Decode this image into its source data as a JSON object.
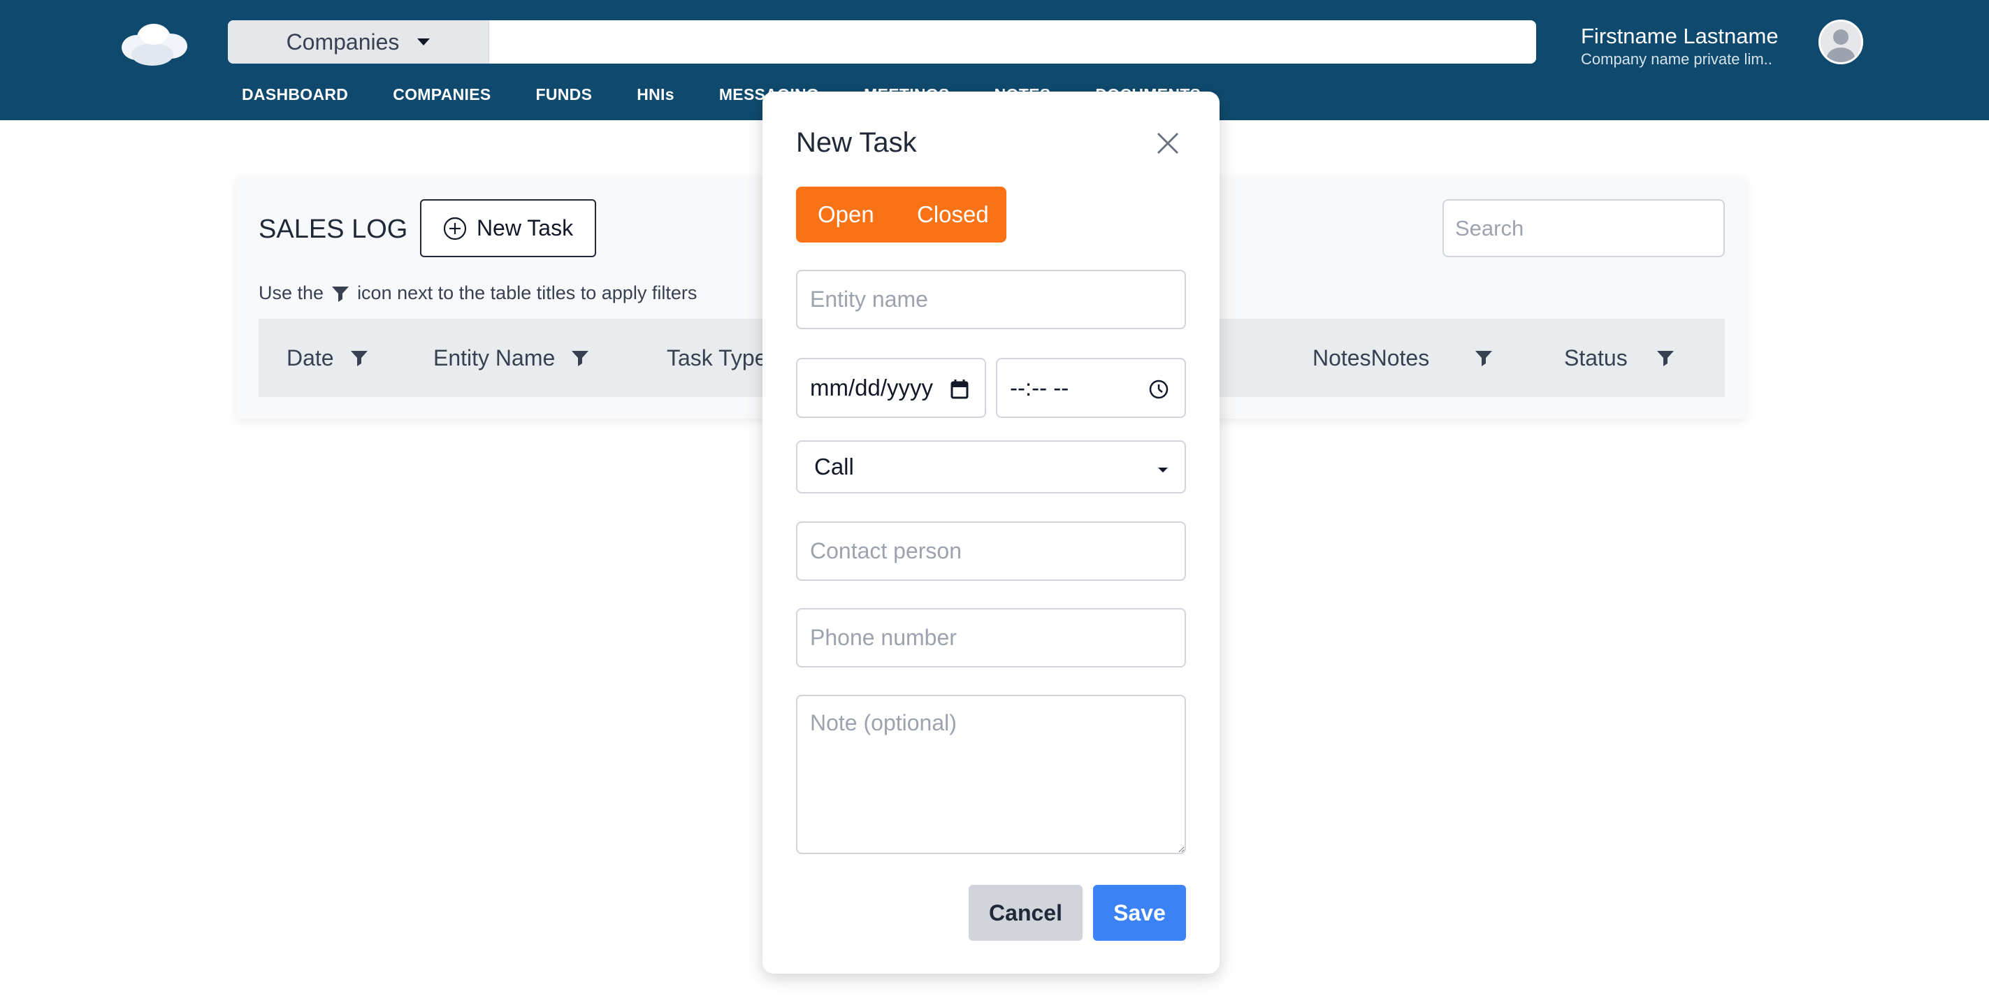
{
  "header": {
    "scope_select": "Companies",
    "search_value": "",
    "user_name": "Firstname Lastname",
    "user_company": "Company name private lim..",
    "nav": [
      "DASHBOARD",
      "COMPANIES",
      "FUNDS",
      "HNIs",
      "MESSAGING",
      "MEETINGS",
      "NOTES",
      "DOCUMENTS"
    ]
  },
  "sales_log": {
    "title": "SALES LOG",
    "new_task_label": "New Task",
    "hint_before": "Use the",
    "hint_after": "icon next to the table titles to apply filters",
    "search_placeholder": "Search",
    "columns": [
      "Date",
      "Entity Name",
      "Task Type",
      "NotesNotes",
      "Status"
    ]
  },
  "modal": {
    "title": "New Task",
    "status_options": [
      "Open",
      "Closed"
    ],
    "entity_placeholder": "Entity name",
    "date_value": "mm/dd/yyyy",
    "time_value": "--:-- --",
    "task_type": "Call",
    "contact_placeholder": "Contact person",
    "phone_placeholder": "Phone number",
    "note_placeholder": "Note (optional)",
    "cancel_label": "Cancel",
    "save_label": "Save"
  },
  "colors": {
    "header_bg": "#0f4a6e",
    "toggle_accent": "#f97316",
    "primary_button": "#3b82f6",
    "cancel_button": "#d1d5db"
  },
  "icons": [
    "cloud-logo-icon",
    "chevron-down-icon",
    "avatar-icon",
    "plus-circle-icon",
    "filter-icon",
    "close-icon",
    "calendar-icon",
    "clock-icon",
    "resize-grip-icon"
  ]
}
